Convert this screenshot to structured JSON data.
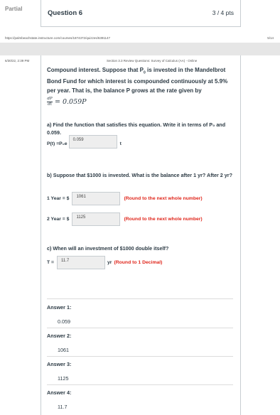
{
  "header": {
    "partial_label": "Partial",
    "question_title": "Question 6",
    "points": "3 / 4 pts",
    "print_url": "https://palmbeachstate.instructure.com/courses/1874372/quizzes/6391147",
    "print_page": "5/14"
  },
  "page2": {
    "print_date": "6/30/22, 2:39 PM",
    "print_title": "Section 3.3 Review Questions: Survey of Calculus (AA) - Online"
  },
  "question": {
    "statement_a": "Compound interest. Suppose that P",
    "statement_sub": "0",
    "statement_b": " is invested in the Mandelbrot Bond Fund for which interest is compounded continuously at 5.9% per year. That is, the balance P grows at the rate given by",
    "eq_num": "dP",
    "eq_den": "dt",
    "eq_rhs": "= 0.059P",
    "part_a": "a) Find the function that satisfies this equation. Write it in terms of P₀ and 0.059.",
    "part_a_prefix": "P(t) =P₀e",
    "part_a_value": "0.059",
    "part_a_suffix": "t",
    "part_b": "b) Suppose that $1000 is invested. What is the balance after 1 yr? After 2 yr?",
    "year1_label": "1 Year = $",
    "year1_value": "1061",
    "year2_label": "2 Year = $",
    "year2_value": "1125",
    "round_whole": "(Round to the next whole number)",
    "part_c": "c) When will an investment of $1000 double itself?",
    "t_label": "T =",
    "t_value": "11.7",
    "t_unit": "yr",
    "round_decimal": "(Round to 1 Decimal)"
  },
  "answers": [
    {
      "label": "Answer 1:",
      "value": "0.059"
    },
    {
      "label": "Answer 2:",
      "value": "1061"
    },
    {
      "label": "Answer 3:",
      "value": "1125"
    },
    {
      "label": "Answer 4:",
      "value": "11.7"
    }
  ]
}
